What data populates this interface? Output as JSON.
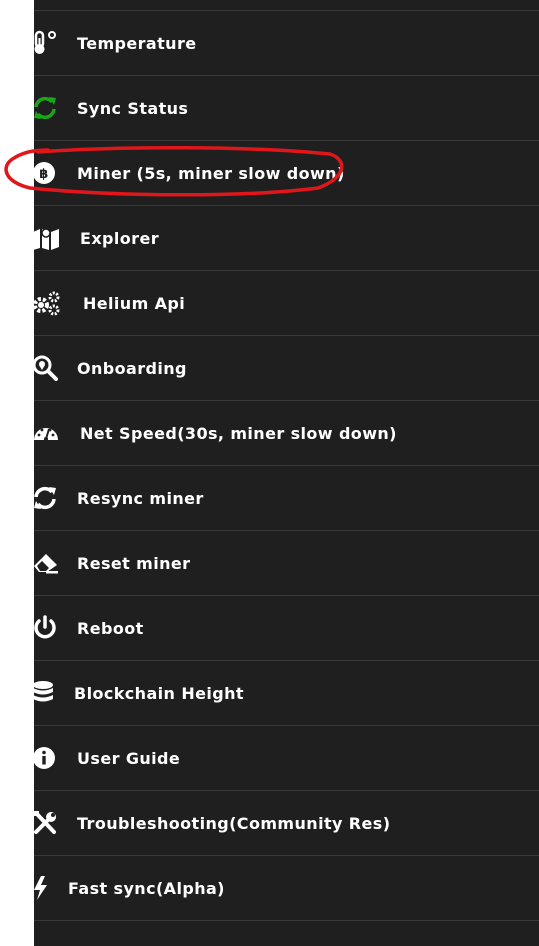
{
  "menu": {
    "items": [
      {
        "label": "Temperature",
        "icon": "thermometer-icon"
      },
      {
        "label": "Sync Status",
        "icon": "sync-icon",
        "icon_color": "#1aa51a"
      },
      {
        "label": "Miner (5s, miner slow down)",
        "icon": "bitcoin-icon"
      },
      {
        "label": "Explorer",
        "icon": "map-icon"
      },
      {
        "label": "Helium Api",
        "icon": "gears-icon"
      },
      {
        "label": "Onboarding",
        "icon": "search-location-icon"
      },
      {
        "label": "Net Speed(30s, miner slow down)",
        "icon": "speedometer-icon"
      },
      {
        "label": "Resync miner",
        "icon": "redo-icon"
      },
      {
        "label": "Reset miner",
        "icon": "eraser-icon"
      },
      {
        "label": "Reboot",
        "icon": "power-icon"
      },
      {
        "label": "Blockchain Height",
        "icon": "database-icon"
      },
      {
        "label": "User Guide",
        "icon": "info-icon"
      },
      {
        "label": "Troubleshooting(Community Res)",
        "icon": "tools-icon"
      },
      {
        "label": "Fast sync(Alpha)",
        "icon": "bolt-icon"
      }
    ]
  },
  "colors": {
    "panel_background": "#1f1f1f",
    "divider": "#3a3a3a",
    "text": "#ffffff",
    "annotation": "#e0161b",
    "sync_icon": "#1aa51a"
  }
}
